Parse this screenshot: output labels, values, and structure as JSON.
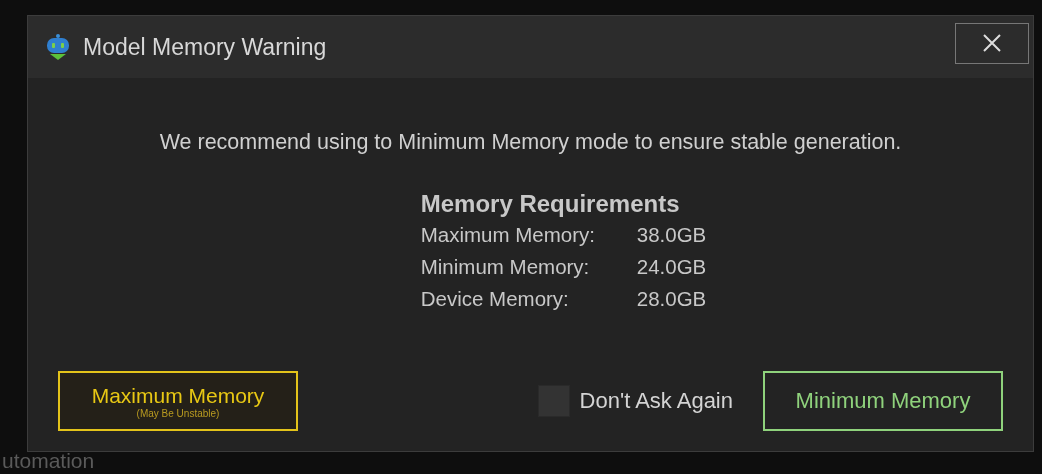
{
  "background": {
    "label": "utomation"
  },
  "dialog": {
    "title": "Model Memory Warning",
    "message": "We recommend using to Minimum Memory mode to ensure stable generation.",
    "requirements": {
      "heading": "Memory Requirements",
      "rows": [
        {
          "label": "Maximum Memory:",
          "value": "38.0GB"
        },
        {
          "label": "Minimum Memory:",
          "value": "24.0GB"
        },
        {
          "label": "Device Memory:",
          "value": "28.0GB"
        }
      ]
    },
    "maximum_button": {
      "label": "Maximum Memory",
      "note": "(May Be Unstable)"
    },
    "dont_ask_again": {
      "label": "Don't Ask Again",
      "checked": false
    },
    "minimum_button": {
      "label": "Minimum Memory"
    }
  }
}
